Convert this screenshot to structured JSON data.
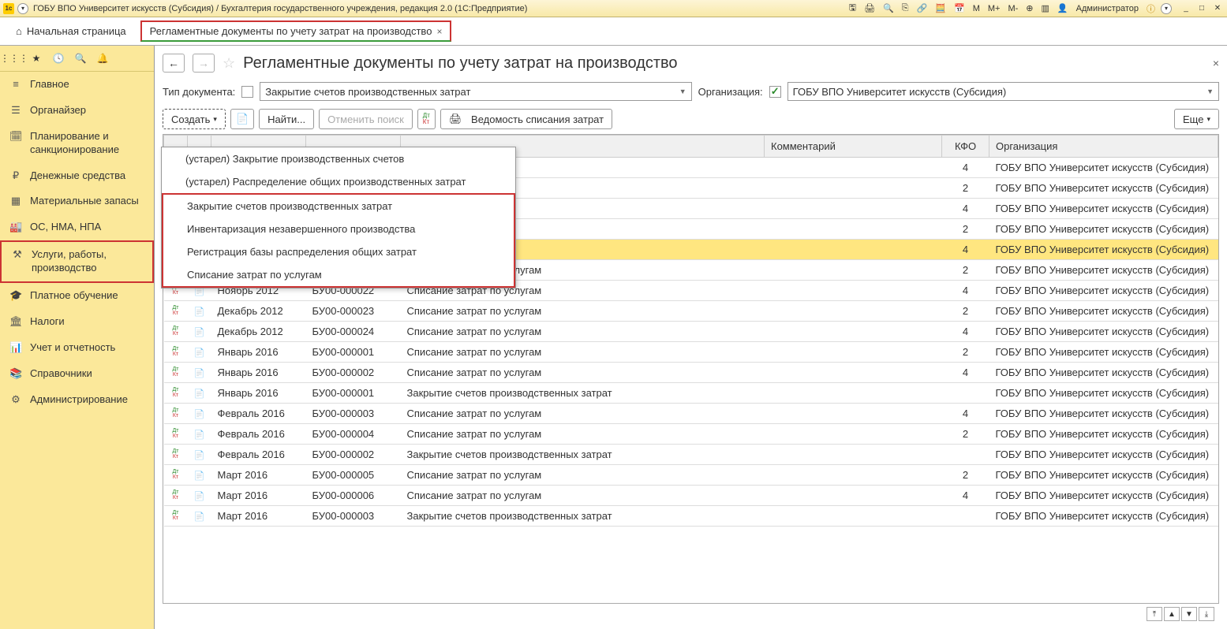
{
  "titlebar": {
    "text": "ГОБУ ВПО Университет искусств (Субсидия) / Бухгалтерия государственного учреждения, редакция 2.0  (1С:Предприятие)",
    "user": "Администратор",
    "m": "M",
    "mplus": "M+",
    "mminus": "M-"
  },
  "tabs": {
    "home": "Начальная страница",
    "active": "Регламентные документы по учету затрат на производство"
  },
  "sidebar": {
    "items": [
      {
        "label": "Главное"
      },
      {
        "label": "Органайзер"
      },
      {
        "label": "Планирование и санкционирование"
      },
      {
        "label": "Денежные средства"
      },
      {
        "label": "Материальные запасы"
      },
      {
        "label": "ОС, НМА, НПА"
      },
      {
        "label": "Услуги, работы, производство"
      },
      {
        "label": "Платное обучение"
      },
      {
        "label": "Налоги"
      },
      {
        "label": "Учет и отчетность"
      },
      {
        "label": "Справочники"
      },
      {
        "label": "Администрирование"
      }
    ]
  },
  "page": {
    "title": "Регламентные документы по учету затрат на производство",
    "doc_type_label": "Тип документа:",
    "doc_type_value": "Закрытие счетов производственных затрат",
    "org_label": "Организация:",
    "org_value": "ГОБУ ВПО Университет искусств (Субсидия)"
  },
  "toolbar": {
    "create": "Создать",
    "find": "Найти...",
    "cancel_search": "Отменить поиск",
    "report": "Ведомость списания затрат",
    "more": "Еще"
  },
  "dropdown": {
    "items": [
      "(устарел) Закрытие производственных счетов",
      "(устарел) Распределение общих производственных затрат",
      "Закрытие счетов производственных затрат",
      "Инвентаризация незавершенного производства",
      "Регистрация базы распределения общих затрат",
      "Списание затрат по услугам"
    ]
  },
  "table": {
    "headers": {
      "comment": "Комментарий",
      "kfo": "КФО",
      "org": "Организация"
    },
    "rows": [
      {
        "date": "",
        "num": "",
        "op": "о услугам",
        "kfo": "4",
        "org": "ГОБУ ВПО Университет искусств (Субсидия)"
      },
      {
        "date": "",
        "num": "",
        "op": "о услугам",
        "kfo": "2",
        "org": "ГОБУ ВПО Университет искусств (Субсидия)"
      },
      {
        "date": "",
        "num": "",
        "op": "о услугам",
        "kfo": "4",
        "org": "ГОБУ ВПО Университет искусств (Субсидия)"
      },
      {
        "date": "",
        "num": "",
        "op": "о услугам",
        "kfo": "2",
        "org": "ГОБУ ВПО Университет искусств (Субсидия)"
      },
      {
        "date": "",
        "num": "",
        "op": "о услугам",
        "kfo": "4",
        "org": "ГОБУ ВПО Университет искусств (Субсидия)",
        "selected": true
      },
      {
        "date": "Ноябрь 2012",
        "num": "БУ00-000021",
        "op": "Списание затрат по услугам",
        "kfo": "2",
        "org": "ГОБУ ВПО Университет искусств (Субсидия)"
      },
      {
        "date": "Ноябрь 2012",
        "num": "БУ00-000022",
        "op": "Списание затрат по услугам",
        "kfo": "4",
        "org": "ГОБУ ВПО Университет искусств (Субсидия)"
      },
      {
        "date": "Декабрь 2012",
        "num": "БУ00-000023",
        "op": "Списание затрат по услугам",
        "kfo": "2",
        "org": "ГОБУ ВПО Университет искусств (Субсидия)"
      },
      {
        "date": "Декабрь 2012",
        "num": "БУ00-000024",
        "op": "Списание затрат по услугам",
        "kfo": "4",
        "org": "ГОБУ ВПО Университет искусств (Субсидия)"
      },
      {
        "date": "Январь 2016",
        "num": "БУ00-000001",
        "op": "Списание затрат по услугам",
        "kfo": "2",
        "org": "ГОБУ ВПО Университет искусств (Субсидия)"
      },
      {
        "date": "Январь 2016",
        "num": "БУ00-000002",
        "op": "Списание затрат по услугам",
        "kfo": "4",
        "org": "ГОБУ ВПО Университет искусств (Субсидия)"
      },
      {
        "date": "Январь 2016",
        "num": "БУ00-000001",
        "op": "Закрытие счетов производственных затрат",
        "kfo": "",
        "org": "ГОБУ ВПО Университет искусств (Субсидия)"
      },
      {
        "date": "Февраль 2016",
        "num": "БУ00-000003",
        "op": "Списание затрат по услугам",
        "kfo": "4",
        "org": "ГОБУ ВПО Университет искусств (Субсидия)"
      },
      {
        "date": "Февраль 2016",
        "num": "БУ00-000004",
        "op": "Списание затрат по услугам",
        "kfo": "2",
        "org": "ГОБУ ВПО Университет искусств (Субсидия)"
      },
      {
        "date": "Февраль 2016",
        "num": "БУ00-000002",
        "op": "Закрытие счетов производственных затрат",
        "kfo": "",
        "org": "ГОБУ ВПО Университет искусств (Субсидия)"
      },
      {
        "date": "Март 2016",
        "num": "БУ00-000005",
        "op": "Списание затрат по услугам",
        "kfo": "2",
        "org": "ГОБУ ВПО Университет искусств (Субсидия)"
      },
      {
        "date": "Март 2016",
        "num": "БУ00-000006",
        "op": "Списание затрат по услугам",
        "kfo": "4",
        "org": "ГОБУ ВПО Университет искусств (Субсидия)"
      },
      {
        "date": "Март 2016",
        "num": "БУ00-000003",
        "op": "Закрытие счетов производственных затрат",
        "kfo": "",
        "org": "ГОБУ ВПО Университет искусств (Субсидия)"
      }
    ]
  }
}
